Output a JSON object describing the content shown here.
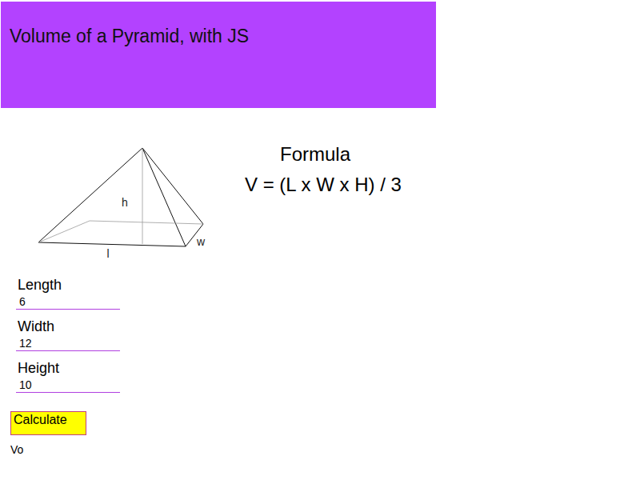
{
  "header": {
    "title": "Volume of a Pyramid, with JS"
  },
  "diagram": {
    "labels": {
      "h": "h",
      "w": "w",
      "l": "l"
    }
  },
  "formula": {
    "heading": "Formula",
    "text": "V = (L x W x H) / 3"
  },
  "form": {
    "fields": [
      {
        "label": "Length",
        "value": "6"
      },
      {
        "label": "Width",
        "value": "12"
      },
      {
        "label": "Height",
        "value": "10"
      }
    ],
    "button": "Calculate",
    "result": "Vo"
  }
}
